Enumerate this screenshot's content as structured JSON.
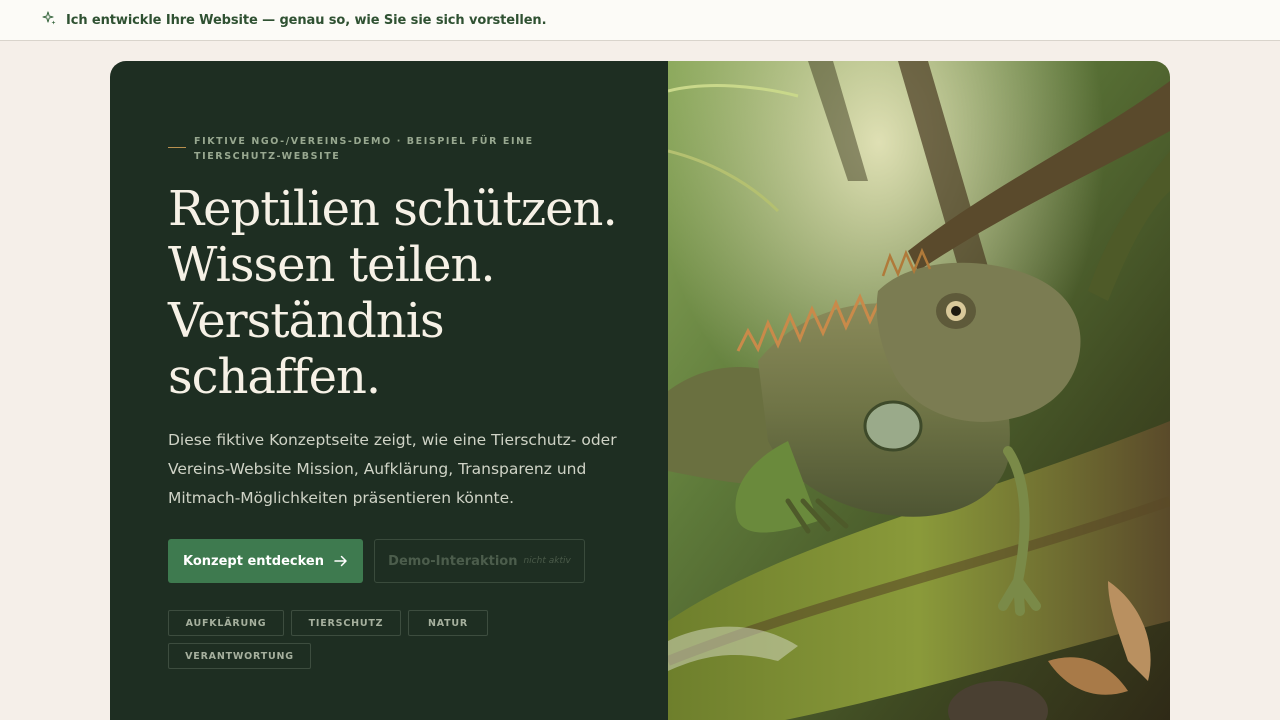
{
  "banner": {
    "icon": "sparkle-icon",
    "text": "Ich entwickle Ihre Website — genau so, wie Sie sie sich vorstellen."
  },
  "hero": {
    "eyebrow": "FIKTIVE NGO-/VEREINS-DEMO · BEISPIEL FÜR EINE TIERSCHUTZ-WEBSITE",
    "headline": [
      "Reptilien schützen.",
      "Wissen teilen.",
      "Verständnis",
      "schaffen."
    ],
    "intro": "Diese fiktive Konzeptseite zeigt, wie eine Tierschutz- oder Vereins-Website Mission, Aufklärung, Transparenz und Mitmach-Möglichkeiten präsentieren könnte.",
    "primary_button": {
      "label": "Konzept entdecken",
      "icon": "arrow-right-icon"
    },
    "secondary_button": {
      "label": "Demo-Interaktion",
      "note": "nicht aktiv"
    },
    "tags": [
      "AUFKLÄRUNG",
      "TIERSCHUTZ",
      "NATUR",
      "VERANTWORTUNG"
    ],
    "image": "iguana-on-mossy-branch"
  },
  "colors": {
    "page_bg": "#f5efe9",
    "hero_dark": "#1e2e22",
    "accent_green": "#3e7a4f",
    "banner_text": "#2f5132"
  }
}
